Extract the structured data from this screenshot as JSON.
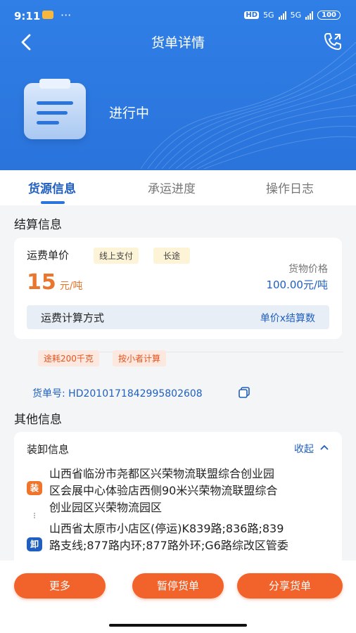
{
  "status_bar": {
    "time": "9:11",
    "more": "···",
    "hd_label": "HD",
    "net1": "5G",
    "net2": "5G",
    "battery": "100"
  },
  "nav": {
    "title": "货单详情"
  },
  "order_status": "进行中",
  "tabs": [
    {
      "label": "货源信息",
      "active": true
    },
    {
      "label": "承运进度",
      "active": false
    },
    {
      "label": "操作日志",
      "active": false
    }
  ],
  "settlement": {
    "section_title": "结算信息",
    "freight_label": "运费单价",
    "tags": [
      "线上支付",
      "长途"
    ],
    "price_value": "15",
    "price_unit": "元/吨",
    "goods_price_label": "货物价格",
    "goods_price_value": "100.00元/吨",
    "calc_label": "运费计算方式",
    "calc_value": "单价x结算数",
    "extra_tags": [
      "途耗200千克",
      "按小者计算"
    ]
  },
  "order_no": {
    "label": "货单号:",
    "value": "HD2010171842995802608"
  },
  "other": {
    "section_title": "其他信息",
    "loading_title": "装卸信息",
    "collapse_label": "收起",
    "load_badge": "装",
    "load_address_lines": [
      "山西省临汾市尧都区兴荣物流联盟综合创业园",
      "区会展中心体验店西侧90米兴荣物流联盟综合",
      "创业园区兴荣物流园区"
    ],
    "unload_badge": "卸",
    "unload_address_lines": [
      "山西省太原市小店区(停运)K839路;836路;839",
      "路支线;877路内环;877路外环;G6路综改区管委"
    ]
  },
  "actions": {
    "more": "更多",
    "pause": "暂停货单",
    "share": "分享货单"
  },
  "colors": {
    "brand_blue": "#2a74dc",
    "accent_orange": "#f2622b"
  }
}
